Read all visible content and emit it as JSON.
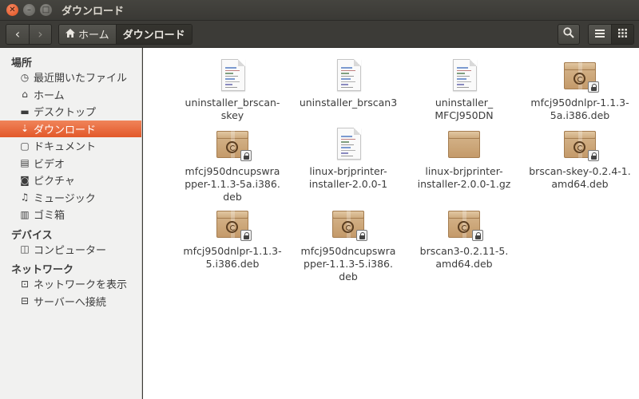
{
  "window": {
    "title": "ダウンロード",
    "close_glyph": "✕",
    "min_glyph": "–",
    "max_glyph": "□"
  },
  "toolbar": {
    "back_icon": "‹",
    "forward_icon": "›",
    "path": [
      {
        "label": "ホーム",
        "icon": "home-icon"
      },
      {
        "label": "ダウンロード",
        "active": true
      }
    ],
    "search_icon": "search-icon",
    "view_list_icon": "list-view-icon",
    "view_grid_icon": "grid-view-icon"
  },
  "sidebar": {
    "places_header": "場所",
    "places": [
      {
        "label": "最近開いたファイル",
        "icon": "clock-icon",
        "glyph": "◷"
      },
      {
        "label": "ホーム",
        "icon": "home-icon",
        "glyph": "⌂"
      },
      {
        "label": "デスクトップ",
        "icon": "folder-icon",
        "glyph": "▬"
      },
      {
        "label": "ダウンロード",
        "icon": "download-icon",
        "glyph": "⇣",
        "active": true
      },
      {
        "label": "ドキュメント",
        "icon": "document-icon",
        "glyph": "▢"
      },
      {
        "label": "ビデオ",
        "icon": "film-icon",
        "glyph": "▤"
      },
      {
        "label": "ピクチャ",
        "icon": "camera-icon",
        "glyph": "◙"
      },
      {
        "label": "ミュージック",
        "icon": "music-icon",
        "glyph": "♫"
      },
      {
        "label": "ゴミ箱",
        "icon": "trash-icon",
        "glyph": "▥"
      }
    ],
    "devices_header": "デバイス",
    "devices": [
      {
        "label": "コンピューター",
        "icon": "computer-icon",
        "glyph": "◫"
      }
    ],
    "network_header": "ネットワーク",
    "network": [
      {
        "label": "ネットワークを表示",
        "icon": "network-icon",
        "glyph": "⊡"
      },
      {
        "label": "サーバーへ接続",
        "icon": "server-icon",
        "glyph": "⊟"
      }
    ]
  },
  "files": [
    {
      "name": "uninstaller_brscan-skey",
      "type": "text"
    },
    {
      "name": "uninstaller_brscan3",
      "type": "text"
    },
    {
      "name": "uninstaller_\nMFCJ950DN",
      "type": "text"
    },
    {
      "name": "mfcj950dnlpr-1.1.3-5a.i386.deb",
      "type": "deb"
    },
    {
      "name": "mfcj950dncupswrapper-1.1.3-5a.i386.deb",
      "type": "deb"
    },
    {
      "name": "linux-brjprinter-installer-2.0.0-1",
      "type": "text"
    },
    {
      "name": "linux-brjprinter-installer-2.0.0-1.gz",
      "type": "archive"
    },
    {
      "name": "brscan-skey-0.2.4-1.amd64.deb",
      "type": "deb"
    },
    {
      "name": "mfcj950dnlpr-1.1.3-5.i386.deb",
      "type": "deb"
    },
    {
      "name": "mfcj950dncupswrapper-1.1.3-5.i386.deb",
      "type": "deb"
    },
    {
      "name": "brscan3-0.2.11-5.amd64.deb",
      "type": "deb"
    }
  ],
  "file_name_lines": [
    [
      "uninstaller_brscan-",
      "skey"
    ],
    [
      "uninstaller_brscan3"
    ],
    [
      "uninstaller_",
      "MFCJ950DN"
    ],
    [
      "mfcj950dnlpr-1.1.3-",
      "5a.i386.deb"
    ],
    [
      "mfcj950dncupswra",
      "pper-1.1.3-5a.i386.",
      "deb"
    ],
    [
      "linux-brjprinter-",
      "installer-2.0.0-1"
    ],
    [
      "linux-brjprinter-",
      "installer-2.0.0-1.gz"
    ],
    [
      "brscan-skey-0.2.4-1.",
      "amd64.deb"
    ],
    [
      "mfcj950dnlpr-1.1.3-",
      "5.i386.deb"
    ],
    [
      "mfcj950dncupswra",
      "pper-1.1.3-5.i386.",
      "deb"
    ],
    [
      "brscan3-0.2.11-5.",
      "amd64.deb"
    ]
  ]
}
